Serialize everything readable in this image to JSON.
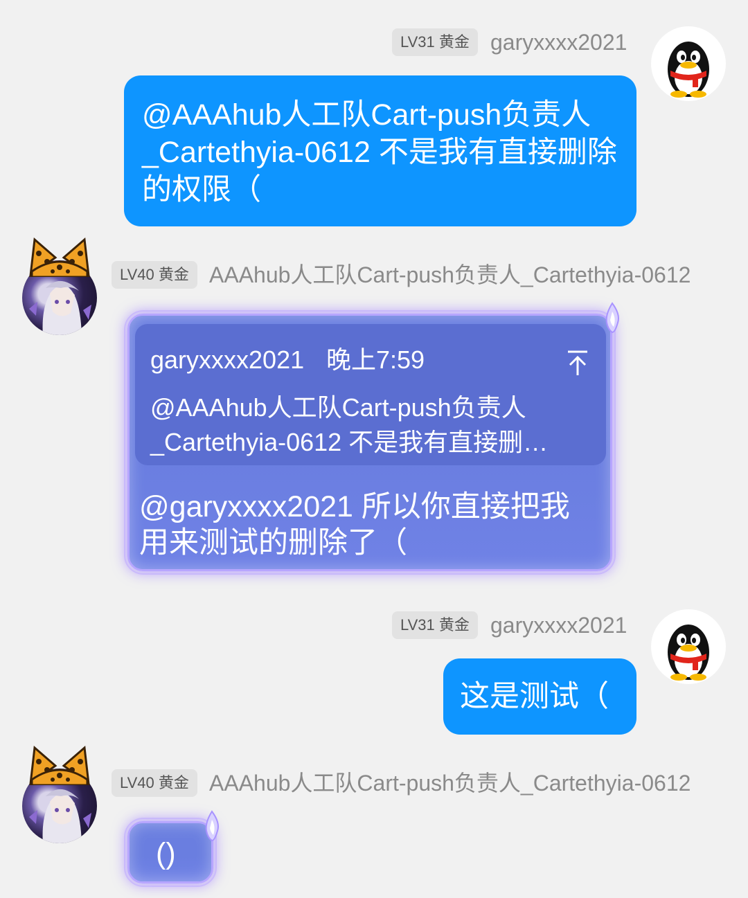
{
  "messages": [
    {
      "badge": "LV31 黄金",
      "nick": "garyxxxx2021",
      "text": "@AAAhub人工队Cart-push负责人_Cartethyia-0612 不是我有直接删除的权限（"
    },
    {
      "badge": "LV40 黄金",
      "nick": "AAAhub人工队Cart-push负责人_Cartethyia-0612",
      "quote": {
        "author": "garyxxxx2021",
        "time": "晚上7:59",
        "line1": "@AAAhub人工队Cart-push负责人",
        "line2": "_Cartethyia-0612 不是我有直接删…"
      },
      "text_line1": "@garyxxxx2021 所以你直接把我",
      "text_line2": "用来测试的删除了（"
    },
    {
      "badge": "LV31 黄金",
      "nick": "garyxxxx2021",
      "text": "这是测试（"
    },
    {
      "badge": "LV40 黄金",
      "nick": "AAAhub人工队Cart-push负责人_Cartethyia-0612",
      "text": "()"
    }
  ],
  "colors": {
    "background": "#f1f1f1",
    "blue_bubble": "#0e95ff",
    "fancy_bubble": "#6b7fe0",
    "quote_box": "#5b6ed1",
    "badge_bg": "#e2e2e2"
  },
  "icons": {
    "self_avatar": "qq-penguin-icon",
    "other_avatar": "anime-avatar-with-leopard-ears",
    "quote_jump": "arrow-up-to-top-icon",
    "bubble_decoration": "sparkle-flame-icon"
  }
}
